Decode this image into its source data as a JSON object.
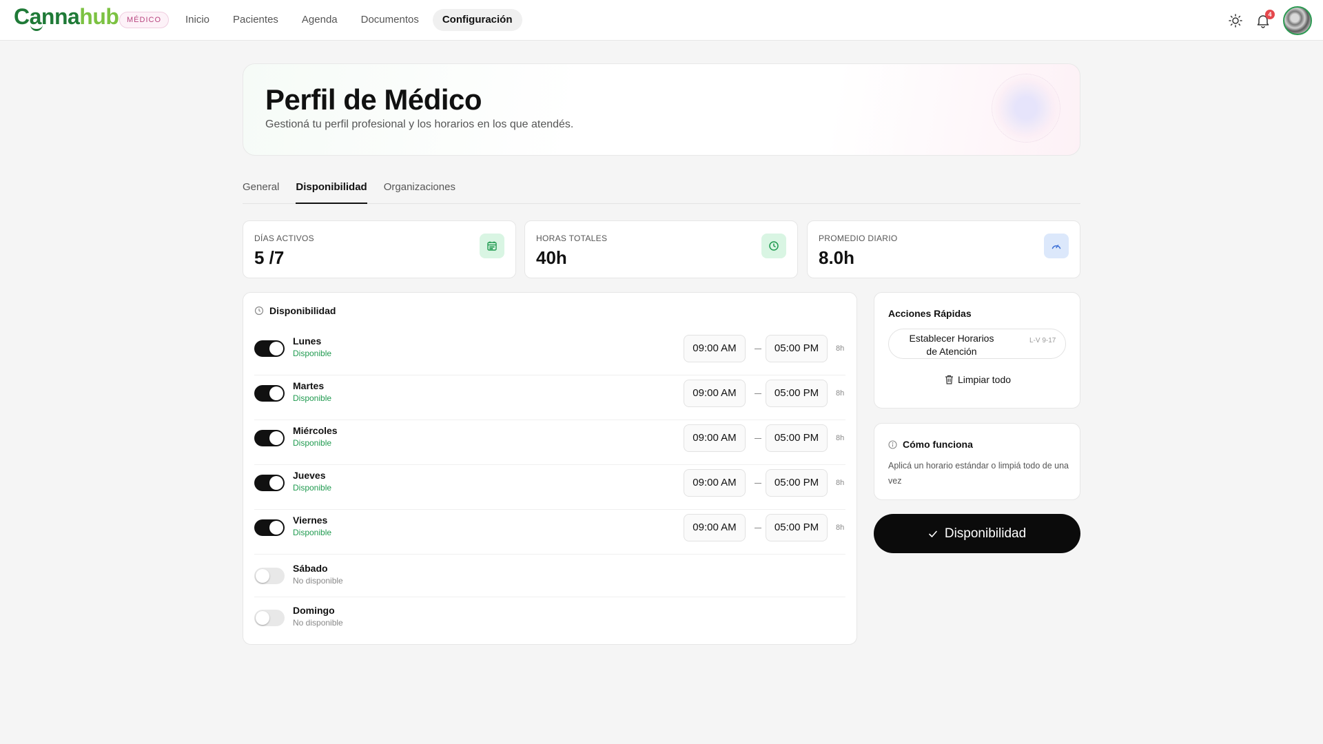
{
  "brand": {
    "part1": "Canna",
    "part2": "hub",
    "role_badge": "MÉDICO"
  },
  "nav": {
    "items": [
      "Inicio",
      "Pacientes",
      "Agenda",
      "Documentos",
      "Configuración"
    ],
    "active": "Configuración"
  },
  "header_icons": {
    "theme": "sun-icon",
    "notifications": "bell-icon",
    "notification_count": "4"
  },
  "hero": {
    "title": "Perfil de Médico",
    "subtitle": "Gestioná tu perfil profesional y los horarios en los que atendés."
  },
  "tabs": {
    "items": [
      "General",
      "Disponibilidad",
      "Organizaciones"
    ],
    "active": "Disponibilidad"
  },
  "stats": [
    {
      "label": "DÍAS ACTIVOS",
      "value": "5 /7",
      "icon": "calendar-icon",
      "accent": "#1f9a4f"
    },
    {
      "label": "HORAS TOTALES",
      "value": "40h",
      "icon": "clock-icon",
      "accent": "#1f9a4f"
    },
    {
      "label": "PROMEDIO DIARIO",
      "value": "8.0h",
      "icon": "gauge-icon",
      "accent": "#3b6fd6"
    }
  ],
  "availability": {
    "title": "Disponibilidad",
    "days": [
      {
        "name": "Lunes",
        "status": "Disponible",
        "enabled": true,
        "start": "09:00 AM",
        "end": "05:00 PM",
        "hours": "8h"
      },
      {
        "name": "Martes",
        "status": "Disponible",
        "enabled": true,
        "start": "09:00 AM",
        "end": "05:00 PM",
        "hours": "8h"
      },
      {
        "name": "Miércoles",
        "status": "Disponible",
        "enabled": true,
        "start": "09:00 AM",
        "end": "05:00 PM",
        "hours": "8h"
      },
      {
        "name": "Jueves",
        "status": "Disponible",
        "enabled": true,
        "start": "09:00 AM",
        "end": "05:00 PM",
        "hours": "8h"
      },
      {
        "name": "Viernes",
        "status": "Disponible",
        "enabled": true,
        "start": "09:00 AM",
        "end": "05:00 PM",
        "hours": "8h"
      },
      {
        "name": "Sábado",
        "status": "No disponible",
        "enabled": false
      },
      {
        "name": "Domingo",
        "status": "No disponible",
        "enabled": false
      }
    ]
  },
  "quick_actions": {
    "title": "Acciones Rápidas",
    "preset_label": "Establecer Horarios de Atención",
    "preset_tag": "L-V 9-17",
    "clear_label": "Limpiar todo"
  },
  "how_it_works": {
    "title": "Cómo funciona",
    "text": "Aplicá un horario estándar o limpiá todo de una vez"
  },
  "save_button": {
    "label": "Disponibilidad"
  },
  "colors": {
    "available": "#1f9a4f",
    "primary": "#0b0b0b",
    "brand_dark": "#1f7a37",
    "brand_light": "#7cc242"
  }
}
